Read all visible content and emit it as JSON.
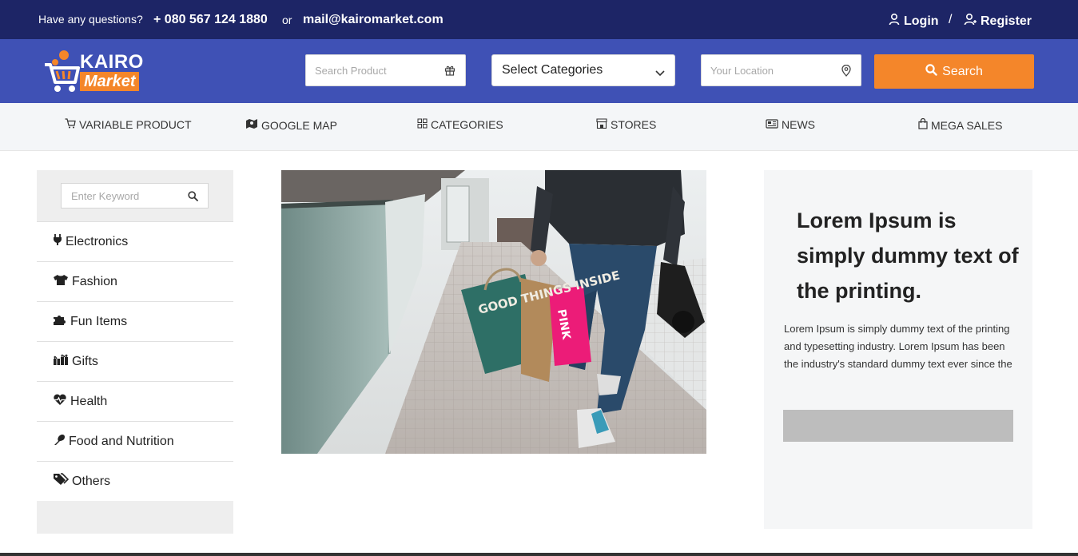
{
  "topbar": {
    "question": "Have any questions?",
    "phone": "+ 080 567 124 1880",
    "or": "or",
    "email": "mail@kairomarket.com",
    "login": "Login",
    "separator": "/",
    "register": "Register"
  },
  "logo": {
    "line1": "KAIRO",
    "line2": "Market"
  },
  "header": {
    "search_placeholder": "Search Product",
    "category_selected": "Select Categories",
    "location_placeholder": "Your Location",
    "search_button": "Search"
  },
  "nav": [
    {
      "label": "VARIABLE PRODUCT",
      "icon": "cart-icon"
    },
    {
      "label": "GOOGLE MAP",
      "icon": "map-icon"
    },
    {
      "label": "CATEGORIES",
      "icon": "grid-icon"
    },
    {
      "label": "STORES",
      "icon": "store-icon"
    },
    {
      "label": "NEWS",
      "icon": "newspaper-icon"
    },
    {
      "label": "MEGA SALES",
      "icon": "bag-icon"
    }
  ],
  "sidebar": {
    "keyword_placeholder": "Enter Keyword",
    "categories": [
      {
        "label": "Electronics",
        "icon": "plug-icon"
      },
      {
        "label": "Fashion",
        "icon": "tshirt-icon"
      },
      {
        "label": "Fun Items",
        "icon": "puzzle-icon"
      },
      {
        "label": "Gifts",
        "icon": "gifts-icon"
      },
      {
        "label": "Health",
        "icon": "heartbeat-icon"
      },
      {
        "label": "Food and Nutrition",
        "icon": "food-icon"
      },
      {
        "label": "Others",
        "icon": "tags-icon"
      }
    ]
  },
  "photo": {
    "bag_text": "GOOD THINGS INSIDE",
    "pink_bag_text": "PINK"
  },
  "card": {
    "title": "Lorem Ipsum is simply dummy text of the printing.",
    "body": "Lorem Ipsum is simply dummy text of the printing and typesetting industry. Lorem Ipsum has been the industry's standard dummy text ever since the"
  },
  "colors": {
    "topbar": "#1d2566",
    "header": "#3f51b5",
    "accent": "#f4862a",
    "nav_bg": "#f4f6f8"
  }
}
